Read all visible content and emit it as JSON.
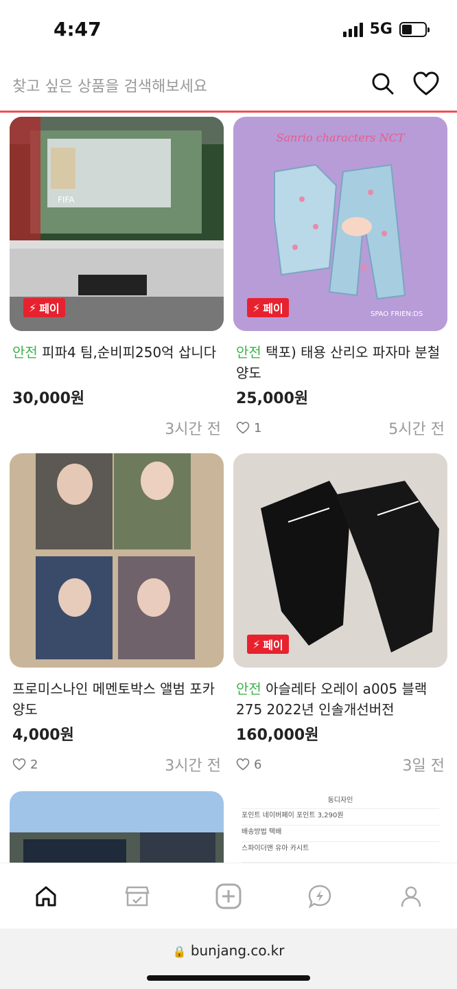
{
  "status": {
    "time": "4:47",
    "network": "5G"
  },
  "search": {
    "placeholder": "찾고 싶은 상품을 검색해보세요"
  },
  "colors": {
    "accent": "#f04e52",
    "pay_badge": "#e7222e",
    "safe": "#3cb44a"
  },
  "pay_badge_label": "페이",
  "safe_label": "안전",
  "products": [
    {
      "safe": true,
      "title": "피파4 팀,순비피250억 삽니다",
      "price": "30,000원",
      "likes": "",
      "time": "3시간 전",
      "pay": true
    },
    {
      "safe": true,
      "title": "택포) 태용 산리오 파자마 분철 양도",
      "price": "25,000원",
      "likes": "1",
      "time": "5시간 전",
      "pay": true
    },
    {
      "safe": false,
      "title": "프로미스나인 메멘토박스 앨범 포카 양도",
      "price": "4,000원",
      "likes": "2",
      "time": "3시간 전",
      "pay": false
    },
    {
      "safe": true,
      "title": "아슬레타 오레이 a005 블랙 275 2022년 인솔개선버전",
      "price": "160,000원",
      "likes": "6",
      "time": "3일 전",
      "pay": true
    }
  ],
  "images": {
    "p1": "FIFA4 game screen on monitor",
    "p2": "SPAO FRIENDS NCT pajama set",
    "p3": "fromis_9 photocards",
    "p4": "black football boots",
    "p5": "car parking lot",
    "p6": "store listing screenshot"
  },
  "partial_images_text": {
    "spao": "SPAO FRIEN:DS",
    "nct_title": "Sanrio characters NCT",
    "fifa_text": "FIFA",
    "p6_lines": [
      "동디자인",
      "포인트 네이버페이 포인트 3,290원",
      "배송방법 택배",
      "스파이더맨 유아 카시트"
    ]
  },
  "nav": {
    "items": [
      "home-icon",
      "store-icon",
      "add-icon",
      "talk-icon",
      "profile-icon"
    ]
  },
  "browser": {
    "url": "bunjang.co.kr"
  }
}
